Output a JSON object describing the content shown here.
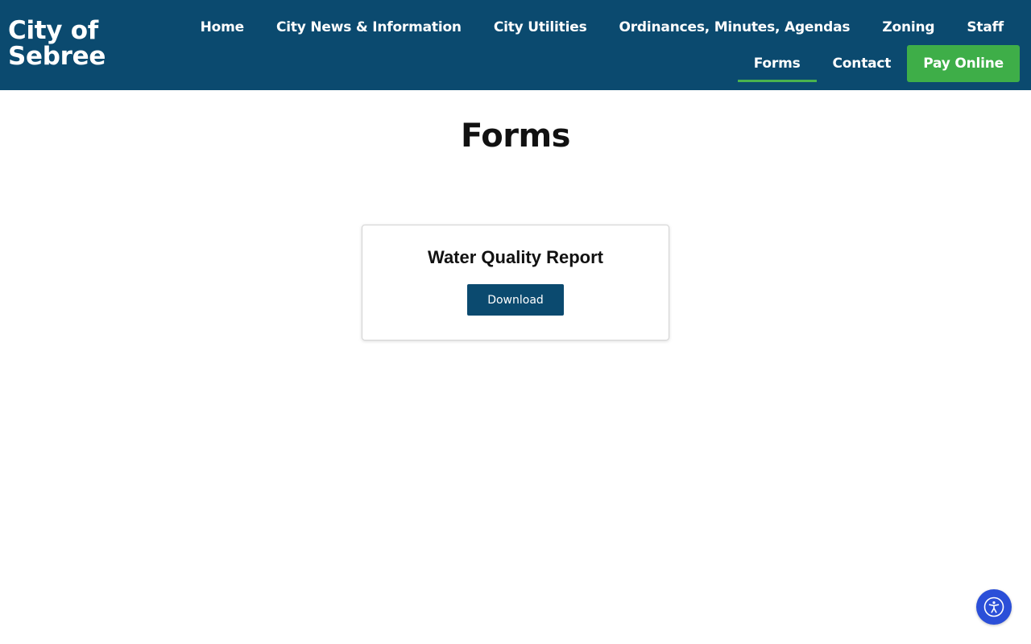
{
  "site": {
    "logo_text": "City of Sebree"
  },
  "nav": {
    "row1": [
      {
        "label": "Home"
      },
      {
        "label": "City News & Information"
      },
      {
        "label": "City Utilities"
      },
      {
        "label": "Ordinances, Minutes, Agendas"
      },
      {
        "label": "Zoning"
      },
      {
        "label": "Staff"
      }
    ],
    "row2": [
      {
        "label": "Forms",
        "active": true
      },
      {
        "label": "Contact"
      }
    ],
    "pay_label": "Pay Online"
  },
  "main": {
    "title": "Forms",
    "cards": [
      {
        "title": "Water Quality Report",
        "button_label": "Download"
      }
    ]
  },
  "accessibility": {
    "icon": "accessibility-icon"
  },
  "colors": {
    "header_bg": "#0b4a6f",
    "accent_green": "#3eae48",
    "active_underline": "#4ab34e",
    "a11y_blue": "#2b4fd8"
  }
}
